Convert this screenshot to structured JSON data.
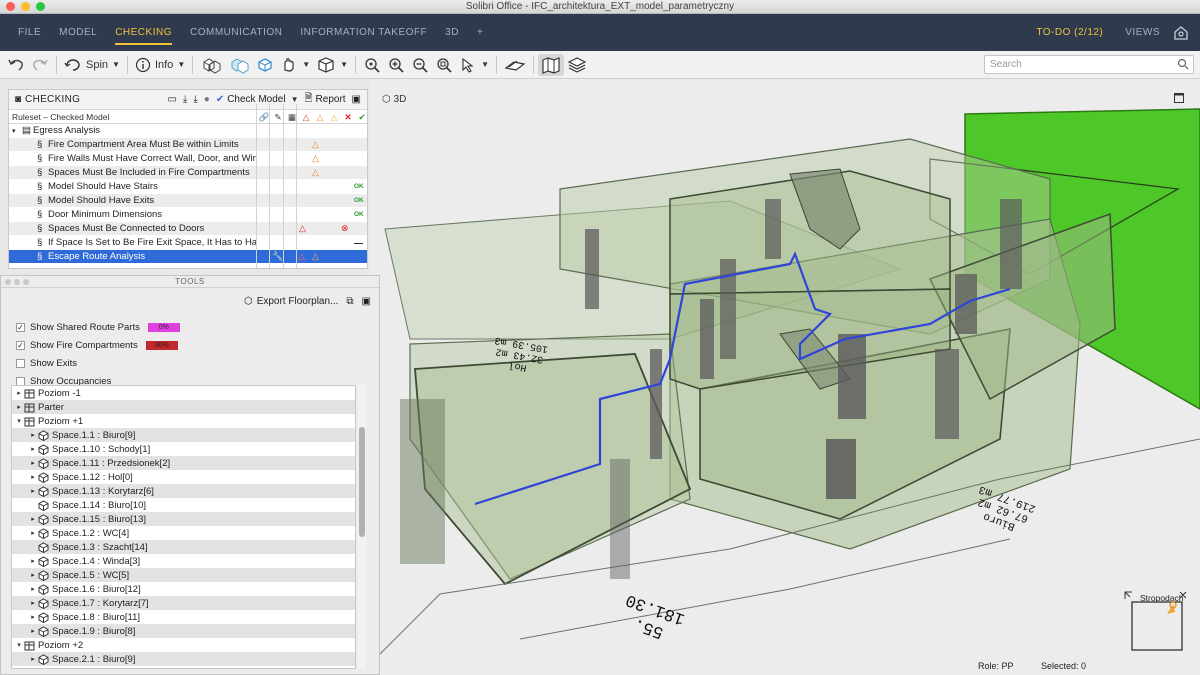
{
  "window": {
    "title": "Solibri Office - IFC_architektura_EXT_model_parametryczny"
  },
  "menu": {
    "items": [
      "FILE",
      "MODEL",
      "CHECKING",
      "COMMUNICATION",
      "INFORMATION TAKEOFF",
      "3D",
      "+"
    ],
    "active": "CHECKING",
    "todo": "TO-DO (2/12)",
    "views": "VIEWS"
  },
  "toolbar": {
    "spin": "Spin",
    "info": "Info",
    "search_placeholder": "Search"
  },
  "viewport": {
    "label": "3D",
    "nav_label": "Stropodach"
  },
  "checking": {
    "title": "CHECKING",
    "check_model": "Check Model",
    "report": "Report",
    "column_header": "Ruleset – Checked Model",
    "group": "Egress Analysis",
    "rules": [
      {
        "name": "Fire Compartment Area Must Be within Limits",
        "status": "warn-orange"
      },
      {
        "name": "Fire Walls Must Have Correct Wall, Door, and Window",
        "status": "warn-orange"
      },
      {
        "name": "Spaces Must Be Included in Fire Compartments",
        "status": "warn-orange"
      },
      {
        "name": "Model Should Have Stairs",
        "status": "ok"
      },
      {
        "name": "Model Should Have Exits",
        "status": "ok"
      },
      {
        "name": "Door Minimum Dimensions",
        "status": "ok"
      },
      {
        "name": "Spaces Must Be Connected to Doors",
        "status": "error"
      },
      {
        "name": "If Space Is Set to Be Fire Exit Space, It Has to Have F",
        "status": "dash"
      },
      {
        "name": "Escape Route Analysis",
        "status": "selected"
      }
    ],
    "ok_label": "OK"
  },
  "tools": {
    "title": "TOOLS",
    "export": "Export Floorplan...",
    "options": [
      {
        "label": "Show Shared Route Parts",
        "checked": true,
        "pct": "0%",
        "color": "#e040e0"
      },
      {
        "label": "Show Fire Compartments",
        "checked": true,
        "pct": "30%",
        "color": "#c0282a"
      },
      {
        "label": "Show Exits",
        "checked": false
      },
      {
        "label": "Show Occupancies",
        "checked": false
      }
    ],
    "tree": [
      {
        "label": "Poziom -1",
        "level": 0,
        "type": "floor",
        "arrow": "▸"
      },
      {
        "label": "Parter",
        "level": 0,
        "type": "floor",
        "arrow": "▸"
      },
      {
        "label": "Poziom +1",
        "level": 0,
        "type": "floor",
        "arrow": "▾"
      },
      {
        "label": "Space.1.1 : Biuro[9]",
        "level": 1,
        "arrow": "▸"
      },
      {
        "label": "Space.1.10 : Schody[1]",
        "level": 1,
        "arrow": "▸"
      },
      {
        "label": "Space.1.11 : Przedsionek[2]",
        "level": 1,
        "arrow": "▸"
      },
      {
        "label": "Space.1.12 : Hol[0]",
        "level": 1,
        "arrow": "▸"
      },
      {
        "label": "Space.1.13 : Korytarz[6]",
        "level": 1,
        "arrow": "▸"
      },
      {
        "label": "Space.1.14 : Biuro[10]",
        "level": 1,
        "arrow": ""
      },
      {
        "label": "Space.1.15 : Biuro[13]",
        "level": 1,
        "arrow": "▸"
      },
      {
        "label": "Space.1.2 : WC[4]",
        "level": 1,
        "arrow": "▸"
      },
      {
        "label": "Space.1.3 : Szacht[14]",
        "level": 1,
        "arrow": ""
      },
      {
        "label": "Space.1.4 : Winda[3]",
        "level": 1,
        "arrow": "▸"
      },
      {
        "label": "Space.1.5 : WC[5]",
        "level": 1,
        "arrow": "▸"
      },
      {
        "label": "Space.1.6 : Biuro[12]",
        "level": 1,
        "arrow": "▸"
      },
      {
        "label": "Space.1.7 : Korytarz[7]",
        "level": 1,
        "arrow": "▸"
      },
      {
        "label": "Space.1.8 : Biuro[11]",
        "level": 1,
        "arrow": "▸"
      },
      {
        "label": "Space.1.9 : Biuro[8]",
        "level": 1,
        "arrow": "▸"
      },
      {
        "label": "Poziom +2",
        "level": 0,
        "type": "floor",
        "arrow": "▾"
      },
      {
        "label": "Space.2.1 : Biuro[9]",
        "level": 1,
        "arrow": "▸"
      }
    ]
  },
  "model_labels": {
    "hol_name": "Hol",
    "hol_area": "32.43 m2",
    "hol_volume": "105.39 m3",
    "biuro_name": "Biuro",
    "biuro_area": "67.62 m2",
    "biuro_volume": "219.77 m3",
    "mid_name": "",
    "mid_area": "",
    "mid_volume": "",
    "big_area": "55.",
    "big_volume": "181.30"
  },
  "status": {
    "role": "Role: PP",
    "selected": "Selected: 0"
  }
}
